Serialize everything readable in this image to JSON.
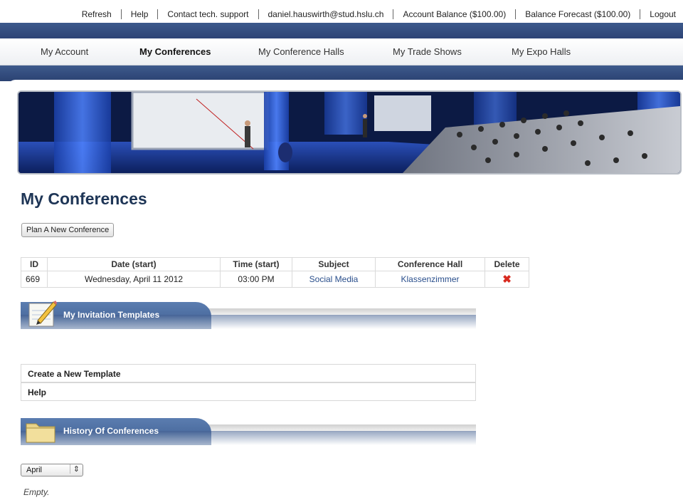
{
  "toplinks": {
    "refresh": "Refresh",
    "help": "Help",
    "contact": "Contact tech. support",
    "email": "daniel.hauswirth@stud.hslu.ch",
    "account_balance": "Account Balance ($100.00)",
    "balance_forecast": "Balance Forecast ($100.00)",
    "logout": "Logout"
  },
  "nav": {
    "items": [
      "My Account",
      "My Conferences",
      "My Conference Halls",
      "My Trade Shows",
      "My Expo Halls"
    ],
    "active": "My Conferences"
  },
  "page": {
    "title": "My Conferences",
    "plan_button": "Plan A New Conference"
  },
  "table": {
    "headers": [
      "ID",
      "Date (start)",
      "Time (start)",
      "Subject",
      "Conference Hall",
      "Delete"
    ],
    "rows": [
      [
        "669",
        "Wednesday, April 11 2012",
        "03:00 PM",
        "Social Media",
        "Klassenzimmer",
        "✖"
      ]
    ]
  },
  "invitations": {
    "title": "My Invitation Templates",
    "items": [
      "Create a New Template",
      "Help"
    ]
  },
  "history": {
    "title": "History Of Conferences",
    "month": "April",
    "empty_text": "Empty."
  },
  "colors": {
    "accent_blue": "#2d4476",
    "title_blue": "#1e3556",
    "link_blue": "#2a4f8c",
    "delete_red": "#d82a1f"
  }
}
